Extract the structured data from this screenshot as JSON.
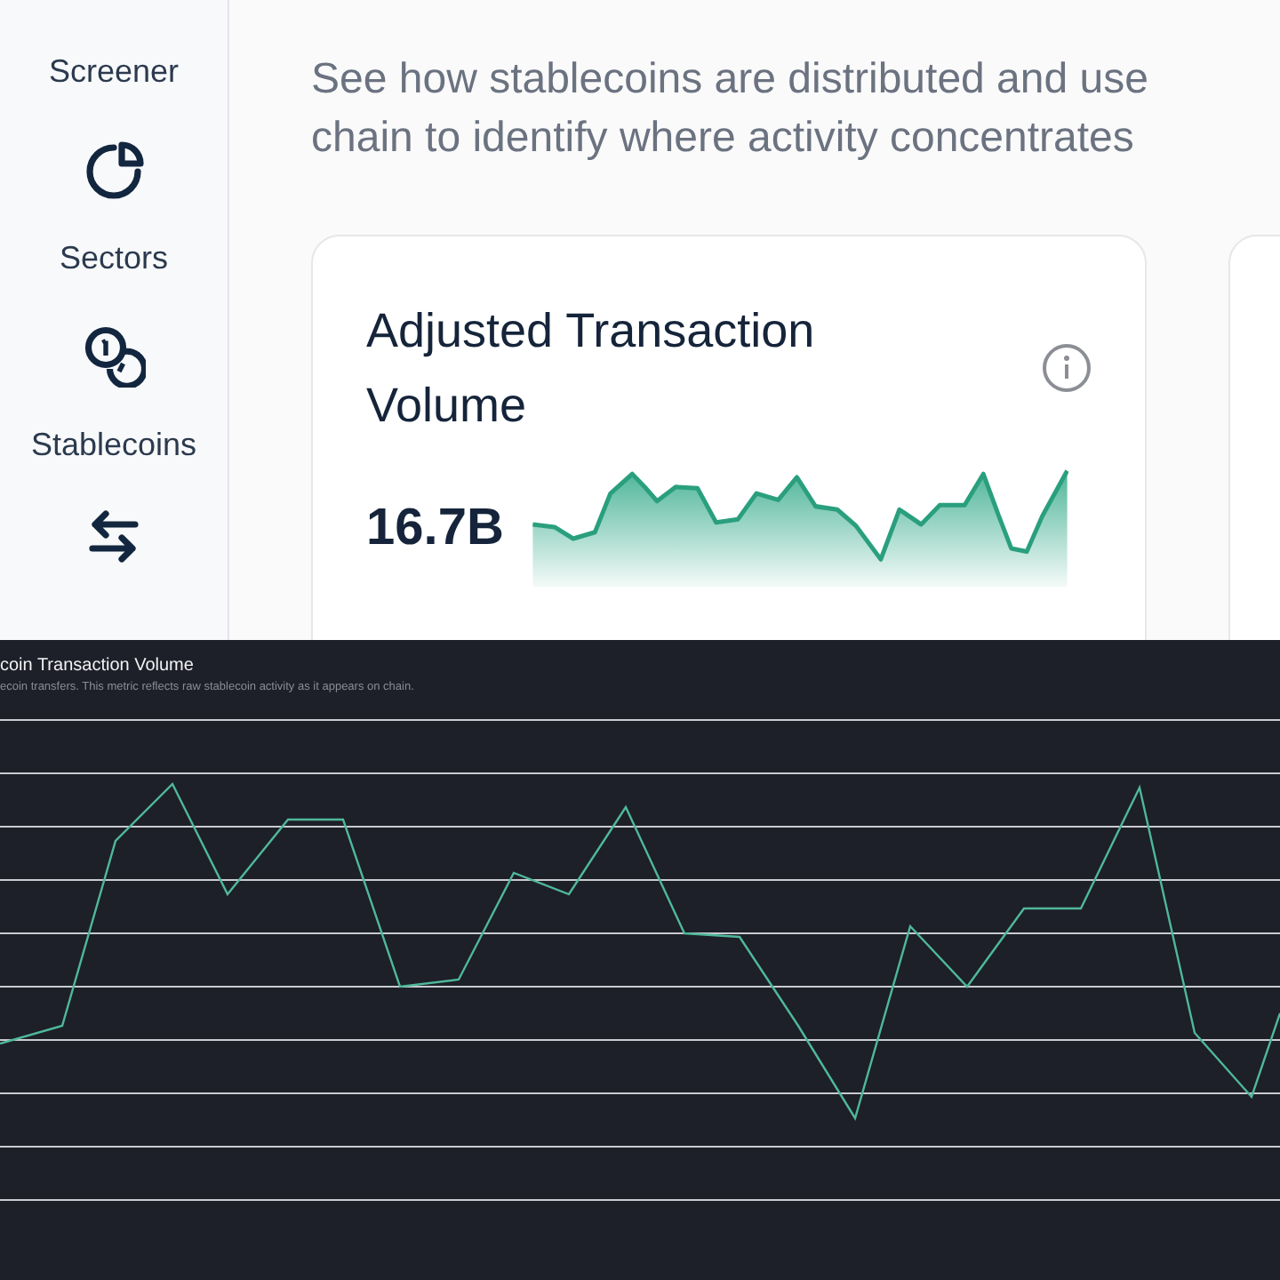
{
  "sidebar": {
    "items": [
      {
        "label": "Screener"
      },
      {
        "label": "Sectors"
      },
      {
        "label": "Stablecoins"
      }
    ]
  },
  "intro": {
    "lines": [
      "See how stablecoins are distributed and use",
      "chain to identify where activity concentrates"
    ]
  },
  "metric_card": {
    "title": "Adjusted Transaction Volume",
    "value": "16.7B"
  },
  "chart_panel": {
    "title": "coin Transaction Volume",
    "subtitle": "ecoin transfers. This metric reflects raw stablecoin activity as it appears on chain."
  }
}
